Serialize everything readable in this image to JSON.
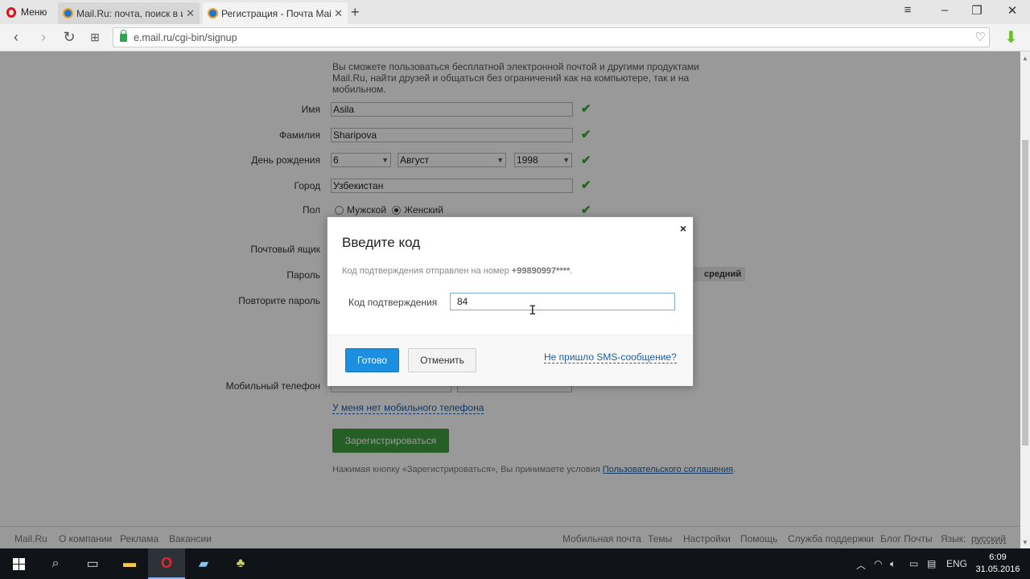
{
  "browser": {
    "menu_label": "Меню",
    "tabs": [
      {
        "title": "Mail.Ru: почта, поиск в интернете"
      },
      {
        "title": "Регистрация - Почта Mail.Ru"
      }
    ],
    "url": "e.mail.ru/cgi-bin/signup"
  },
  "form": {
    "intro": "Вы сможете пользоваться бесплатной электронной почтой и другими продуктами Mail.Ru, найти друзей и общаться без ограничений как на компьютере, так и на мобильном.",
    "first_name": {
      "label": "Имя",
      "value": "Asila"
    },
    "last_name": {
      "label": "Фамилия",
      "value": "Sharipova"
    },
    "birthday": {
      "label": "День рождения",
      "day": "6",
      "month": "Август",
      "year": "1998"
    },
    "city": {
      "label": "Город",
      "value": "Узбекистан"
    },
    "gender": {
      "label": "Пол",
      "male": "Мужской",
      "female": "Женский",
      "selected": "female"
    },
    "mailbox_label": "Почтовый ящик",
    "password_label": "Пароль",
    "password_strength": "средний",
    "repeat_password_label": "Повторите пароль",
    "phone_label": "Мобильный телефон",
    "no_phone_link": "У меня нет мобильного телефона",
    "register_button": "Зарегистрироваться",
    "terms_text": "Нажимая кнопку «Зарегистрироваться», Вы принимаете условия",
    "terms_link": "Пользовательского соглашения",
    "terms_end": "."
  },
  "dialog": {
    "title": "Введите код",
    "info_text": "Код подтверждения отправлен на номер",
    "info_number": "+99890997****",
    "info_end": ".",
    "code_label": "Код подтверждения",
    "code_value": "84",
    "ok_button": "Готово",
    "cancel_button": "Отменить",
    "no_sms_link": "Не пришло SMS-сообщение?",
    "close": "×"
  },
  "footer": {
    "left": [
      "Mail.Ru",
      "О компании",
      "Реклама",
      "Вакансии"
    ],
    "right": [
      "Мобильная почта",
      "Темы",
      "Настройки",
      "Помощь",
      "Служба поддержки",
      "Блог Почты"
    ],
    "lang_label": "Язык:",
    "lang_value": "русский"
  },
  "taskbar": {
    "lang": "ENG",
    "time": "6:09",
    "date": "31.05.2016"
  },
  "colors": {
    "accent_blue": "#1c8fe0",
    "register_green": "#3e9f40",
    "check_green": "#3ea534",
    "link_blue": "#1b5ea8"
  }
}
